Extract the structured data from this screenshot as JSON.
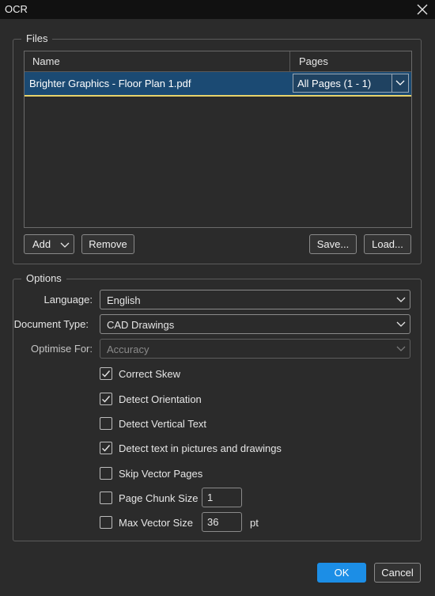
{
  "window": {
    "title": "OCR",
    "close_icon": "close-icon"
  },
  "files": {
    "group_label": "Files",
    "columns": [
      "Name",
      "Pages"
    ],
    "rows": [
      {
        "name": "Brighter Graphics - Floor Plan 1.pdf",
        "pages": "All Pages (1 - 1)",
        "selected": true
      }
    ],
    "buttons": {
      "add": "Add",
      "remove": "Remove",
      "save": "Save...",
      "load": "Load..."
    }
  },
  "options": {
    "group_label": "Options",
    "language": {
      "label": "Language:",
      "value": "English"
    },
    "document_type": {
      "label": "Document Type:",
      "value": "CAD Drawings"
    },
    "optimise_for": {
      "label": "Optimise For:",
      "value": "Accuracy",
      "disabled": true
    },
    "checkboxes": [
      {
        "label": "Correct Skew",
        "checked": true
      },
      {
        "label": "Detect Orientation",
        "checked": true
      },
      {
        "label": "Detect Vertical Text",
        "checked": false
      },
      {
        "label": "Detect text in pictures and drawings",
        "checked": true
      },
      {
        "label": "Skip Vector Pages",
        "checked": false
      },
      {
        "label": "Page Chunk Size",
        "checked": false,
        "value": "1"
      },
      {
        "label": "Max Vector Size",
        "checked": false,
        "value": "36",
        "unit": "pt"
      }
    ]
  },
  "footer": {
    "ok": "OK",
    "cancel": "Cancel"
  },
  "colors": {
    "accent": "#1c8ee6",
    "selection": "#1b4a73",
    "focus_underline": "#e7d36b",
    "background": "#2b2b2b"
  }
}
